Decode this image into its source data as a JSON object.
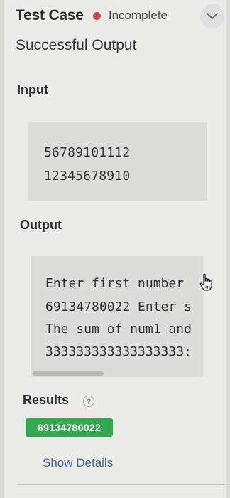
{
  "header": {
    "title": "Test Case",
    "status": "Incomplete",
    "status_color": "#e0404e"
  },
  "subtitle": "Successful Output",
  "input": {
    "label": "Input",
    "lines": [
      "56789101112",
      "12345678910"
    ]
  },
  "output": {
    "label": "Output",
    "lines": [
      "Enter first number",
      "69134780022 Enter s",
      "The sum of num1 and",
      "333333333333333333:"
    ]
  },
  "results": {
    "label": "Results",
    "value": "69134780022",
    "badge_color": "#37a852"
  },
  "show_details_label": "Show Details",
  "icons": {
    "expand": "chevron-down-icon",
    "help": "help-circle-icon",
    "cursor": "hand-pointer-icon"
  }
}
